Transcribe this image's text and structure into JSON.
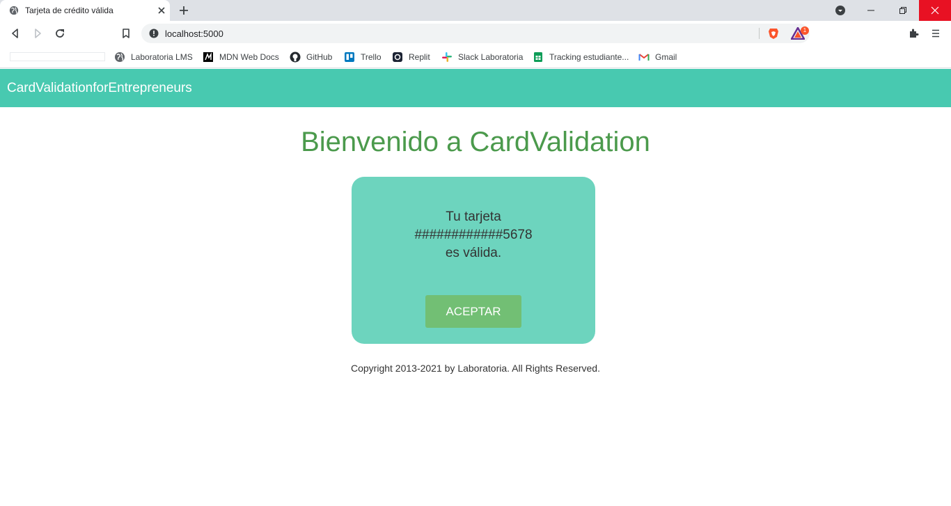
{
  "browser": {
    "tab": {
      "title": "Tarjeta de crédito válida",
      "favicon": "globe-icon"
    },
    "address_bar": {
      "url": "localhost:5000"
    },
    "rewards_badge_count": "1",
    "bookmarks": [
      {
        "label": "Laboratoria LMS",
        "icon": "globe-icon"
      },
      {
        "label": "MDN Web Docs",
        "icon": "mdn-icon"
      },
      {
        "label": "GitHub",
        "icon": "github-icon"
      },
      {
        "label": "Trello",
        "icon": "trello-icon"
      },
      {
        "label": "Replit",
        "icon": "replit-icon"
      },
      {
        "label": "Slack Laboratoria",
        "icon": "slack-icon"
      },
      {
        "label": "Tracking estudiante...",
        "icon": "sheets-icon"
      },
      {
        "label": "Gmail",
        "icon": "gmail-icon"
      }
    ]
  },
  "page": {
    "navbar": {
      "brand": "CardValidationforEntrepreneurs"
    },
    "heading": "Bienvenido a CardValidation",
    "result_card": {
      "line1": "Tu tarjeta",
      "masked_number": "############5678",
      "line3": "es válida.",
      "button_label": "ACEPTAR"
    },
    "footer": "Copyright 2013-2021 by Laboratoria. All Rights Reserved."
  },
  "colors": {
    "navbar": "#48c9b0",
    "heading": "#4b9a4c",
    "card": "#6dd4be",
    "button": "#72bf74",
    "close_button": "#e81123"
  }
}
